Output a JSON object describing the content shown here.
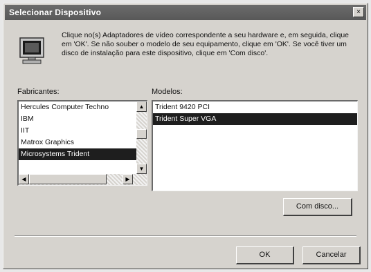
{
  "window": {
    "title": "Selecionar Dispositivo",
    "close_glyph": "×"
  },
  "icon": "monitor-icon",
  "instructions": "Clique no(s) Adaptadores de vídeo correspondente a seu hardware e, em seguida, clique em 'OK'. Se não souber o modelo de seu equipamento, clique em 'OK'. Se você tiver um disco de instalação para este dispositivo, clique em 'Com disco'.",
  "manufacturers": {
    "label": "Fabricantes:",
    "items": [
      "Hercules Computer Techno",
      "IBM",
      "IIT",
      "Matrox Graphics",
      "Microsystems Trident"
    ],
    "selected_index": 4
  },
  "models": {
    "label": "Modelos:",
    "items": [
      "Trident 9420 PCI",
      "Trident Super VGA"
    ],
    "selected_index": 1
  },
  "buttons": {
    "have_disk": "Com disco...",
    "ok": "OK",
    "cancel": "Cancelar"
  },
  "colors": {
    "titlebar": "#585858",
    "selection": "#1e1e1e",
    "face": "#d6d3ce"
  }
}
